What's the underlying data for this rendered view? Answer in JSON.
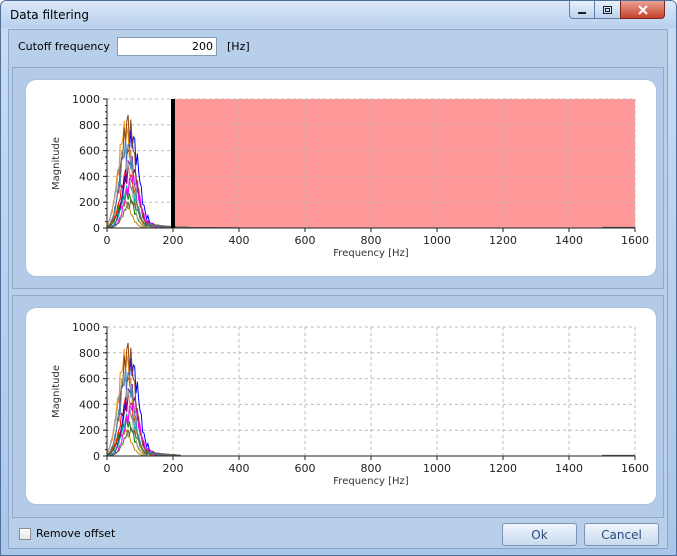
{
  "window": {
    "title": "Data filtering"
  },
  "cutoff": {
    "label": "Cutoff frequency",
    "value": "200",
    "unit": "[Hz]"
  },
  "chart_data": [
    {
      "type": "line",
      "xlabel": "Frequency [Hz]",
      "ylabel": "Magnitude",
      "xlim": [
        0,
        1600
      ],
      "ylim": [
        0,
        1000
      ],
      "xticks": [
        0,
        200,
        400,
        600,
        800,
        1000,
        1200,
        1400,
        1600
      ],
      "yticks": [
        0,
        200,
        400,
        600,
        800,
        1000
      ],
      "grid": true,
      "cutoff_hz": 200,
      "rejected_band": [
        200,
        1600
      ],
      "rejected_band_color": "#ff9999",
      "cutoff_line_color": "#000000",
      "series_peaks_hz": 60,
      "series_max_magnitude": 910
    },
    {
      "type": "line",
      "xlabel": "Frequency [Hz]",
      "ylabel": "Magnitude",
      "xlim": [
        0,
        1600
      ],
      "ylim": [
        0,
        1000
      ],
      "xticks": [
        0,
        200,
        400,
        600,
        800,
        1000,
        1200,
        1400,
        1600
      ],
      "yticks": [
        0,
        200,
        400,
        600,
        800,
        1000
      ],
      "grid": true,
      "series_peaks_hz": 60,
      "series_max_magnitude": 910
    }
  ],
  "footer": {
    "remove_offset_label": "Remove offset",
    "remove_offset_checked": false,
    "ok_label": "Ok",
    "cancel_label": "Cancel"
  },
  "colors": {
    "series": [
      "#b58900",
      "#ff0000",
      "#0000ff",
      "#008000",
      "#800080",
      "#ff8c00",
      "#00aaaa",
      "#a0a0a0",
      "#8b4513",
      "#ff00ff",
      "#4682b4",
      "#556b2f"
    ]
  }
}
